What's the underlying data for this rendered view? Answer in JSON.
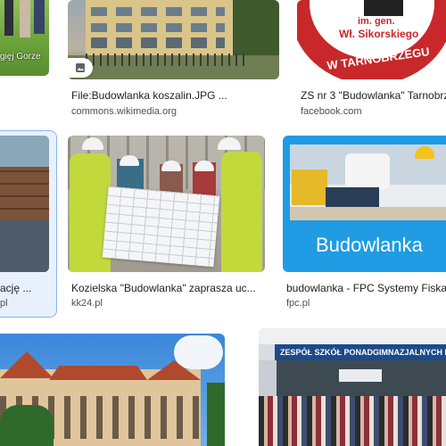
{
  "results": [
    {
      "title": "",
      "source": ""
    },
    {
      "title": "File:Budowlanka koszalin.JPG ...",
      "source": "commons.wikimedia.org"
    },
    {
      "title": "ZS nr 3 \"Budowlanka\" Tarnobrz",
      "source": "facebook.com"
    },
    {
      "title": "ację ...",
      "source": "pl"
    },
    {
      "title": "Kozielska \"Budowlanka\" zaprasza uc...",
      "source": "kk24.pl"
    },
    {
      "title": "budowlanka - FPC Systemy Fiska",
      "source": "fpc.pl"
    }
  ],
  "image_texts": {
    "caption_topleft": "gięj Gorze",
    "logo_line1": "im. gen.",
    "logo_line2": "Wł. Sikorskiego",
    "logo_ring": "W TARNOBRZEGU",
    "fpc_brand": "Budowlanka",
    "school_sign": "ZESPÓŁ SZKÓŁ PONADGIMNAZJALNYCH NR"
  },
  "colors": {
    "selected_bg": "#e8f0fe",
    "selected_border": "#8ab4f8",
    "fpc_blue": "#1f9ce3",
    "logo_red": "#c8282a",
    "sign_blue": "#1c4a8c"
  }
}
